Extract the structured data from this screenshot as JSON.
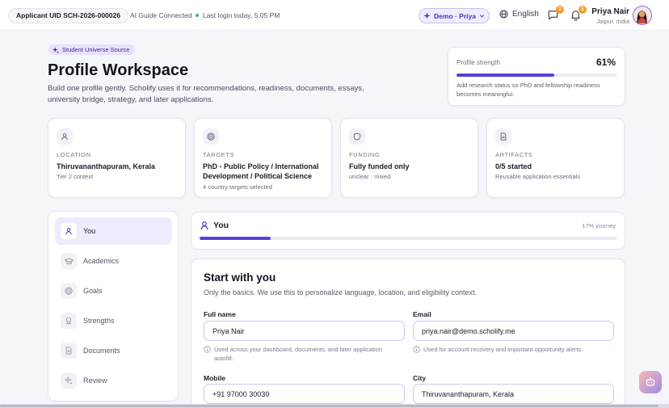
{
  "topbar": {
    "uid": "Applicant UID SCH-2026-000026",
    "ai_status": "AI Guide Connected",
    "last_login": "Last login today, 5:05 PM",
    "demo_label": "Demo · Priya",
    "language": "English",
    "messages_count": "2",
    "notifications_count": "5",
    "user_name": "Priya Nair",
    "user_location": "Jaipur, India"
  },
  "header": {
    "tag": "Student Universe Source",
    "title": "Profile Workspace",
    "subtitle": "Build one profile gently. Scholify uses it for recommendations, readiness, documents, essays, university bridge, strategy, and later applications."
  },
  "strength": {
    "label": "Profile strength",
    "value": "61%",
    "progress": 0.61,
    "note": "Add research status so PhD and fellowship readiness becomes meaningful."
  },
  "stats": [
    {
      "label": "LOCATION",
      "value": "Thiruvananthapuram, Kerala",
      "sub": "Tier 2 context",
      "icon": "user-icon"
    },
    {
      "label": "TARGETS",
      "value": "PhD - Public Policy / International Development / Political Science",
      "sub": "4 country targets selected",
      "icon": "target-icon"
    },
    {
      "label": "FUNDING",
      "value": "Fully funded only",
      "sub": "unclear · mixed",
      "icon": "shield-icon"
    },
    {
      "label": "ARTIFACTS",
      "value": "0/5 started",
      "sub": "Reusable application essentials",
      "icon": "document-icon"
    }
  ],
  "nav": {
    "items": [
      {
        "label": "You",
        "icon": "user-icon",
        "active": true
      },
      {
        "label": "Academics",
        "icon": "graduation-cap-icon",
        "active": false
      },
      {
        "label": "Goals",
        "icon": "target-icon",
        "active": false
      },
      {
        "label": "Strengths",
        "icon": "award-icon",
        "active": false
      },
      {
        "label": "Documents",
        "icon": "document-icon",
        "active": false
      },
      {
        "label": "Review",
        "icon": "sparkles-icon",
        "active": false
      }
    ]
  },
  "journey": {
    "title": "You",
    "percent_label": "17% journey",
    "progress": 0.17
  },
  "form": {
    "title": "Start with you",
    "subtitle": "Only the basics. We use this to personalize language, location, and eligibility context.",
    "full_name_label": "Full name",
    "full_name_value": "Priya Nair",
    "full_name_help": "Used across your dashboard, documents, and later application autofill.",
    "email_label": "Email",
    "email_value": "priya.nair@demo.scholify.me",
    "email_help": "Used for account recovery and important opportunity alerts.",
    "mobile_label": "Mobile",
    "mobile_value": "+91 97000 30030",
    "city_label": "City",
    "city_value": "Thiruvananthapuram, Kerala"
  },
  "colors": {
    "accent": "#5b3fd6",
    "accent_soft": "#efebfd",
    "badge": "#f59e2b",
    "online": "#2fb67c"
  }
}
